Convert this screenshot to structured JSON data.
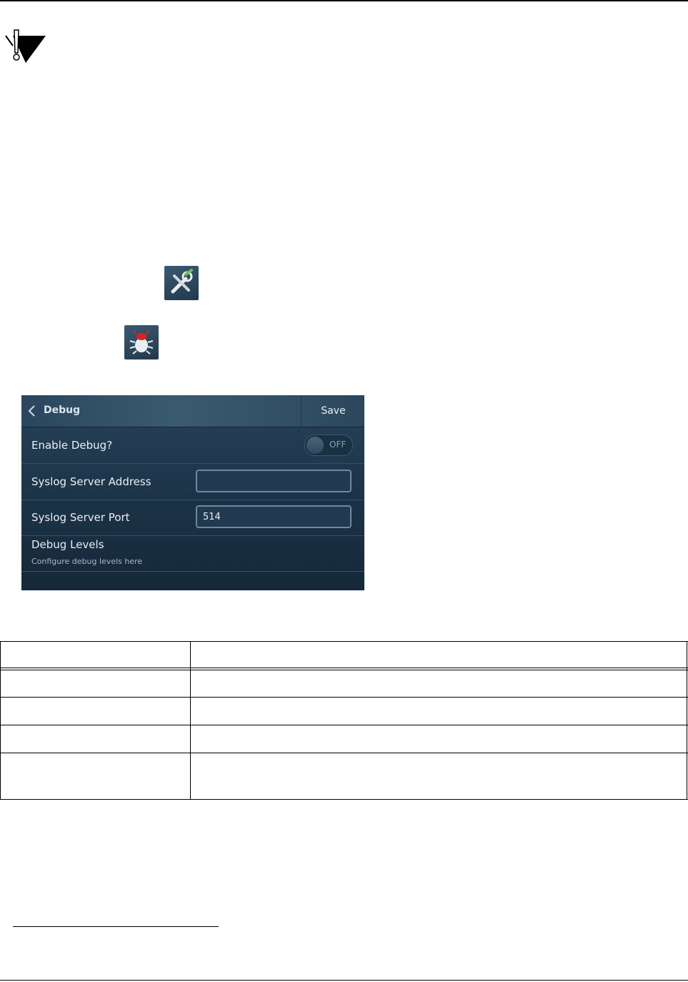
{
  "icons": {
    "caution": "caution-icon",
    "tools": "tools-icon",
    "debug": "bug-icon"
  },
  "debug_screen": {
    "title": "Debug",
    "save_label": "Save",
    "rows": {
      "enable_debug": {
        "label": "Enable Debug?",
        "toggle_state": "OFF"
      },
      "syslog_address": {
        "label": "Syslog Server Address",
        "value": ""
      },
      "syslog_port": {
        "label": "Syslog Server Port",
        "value": "514"
      },
      "debug_levels": {
        "label": "Debug Levels",
        "subtitle": "Configure debug levels here"
      }
    },
    "colors": {
      "background": "#1c3347",
      "header": "#3a5a70",
      "input_border": "#6a8aa6",
      "bug_accent": "#e02020",
      "tool_accent": "#6cc24a"
    }
  },
  "table": {
    "columns": 2,
    "rows": 5
  }
}
